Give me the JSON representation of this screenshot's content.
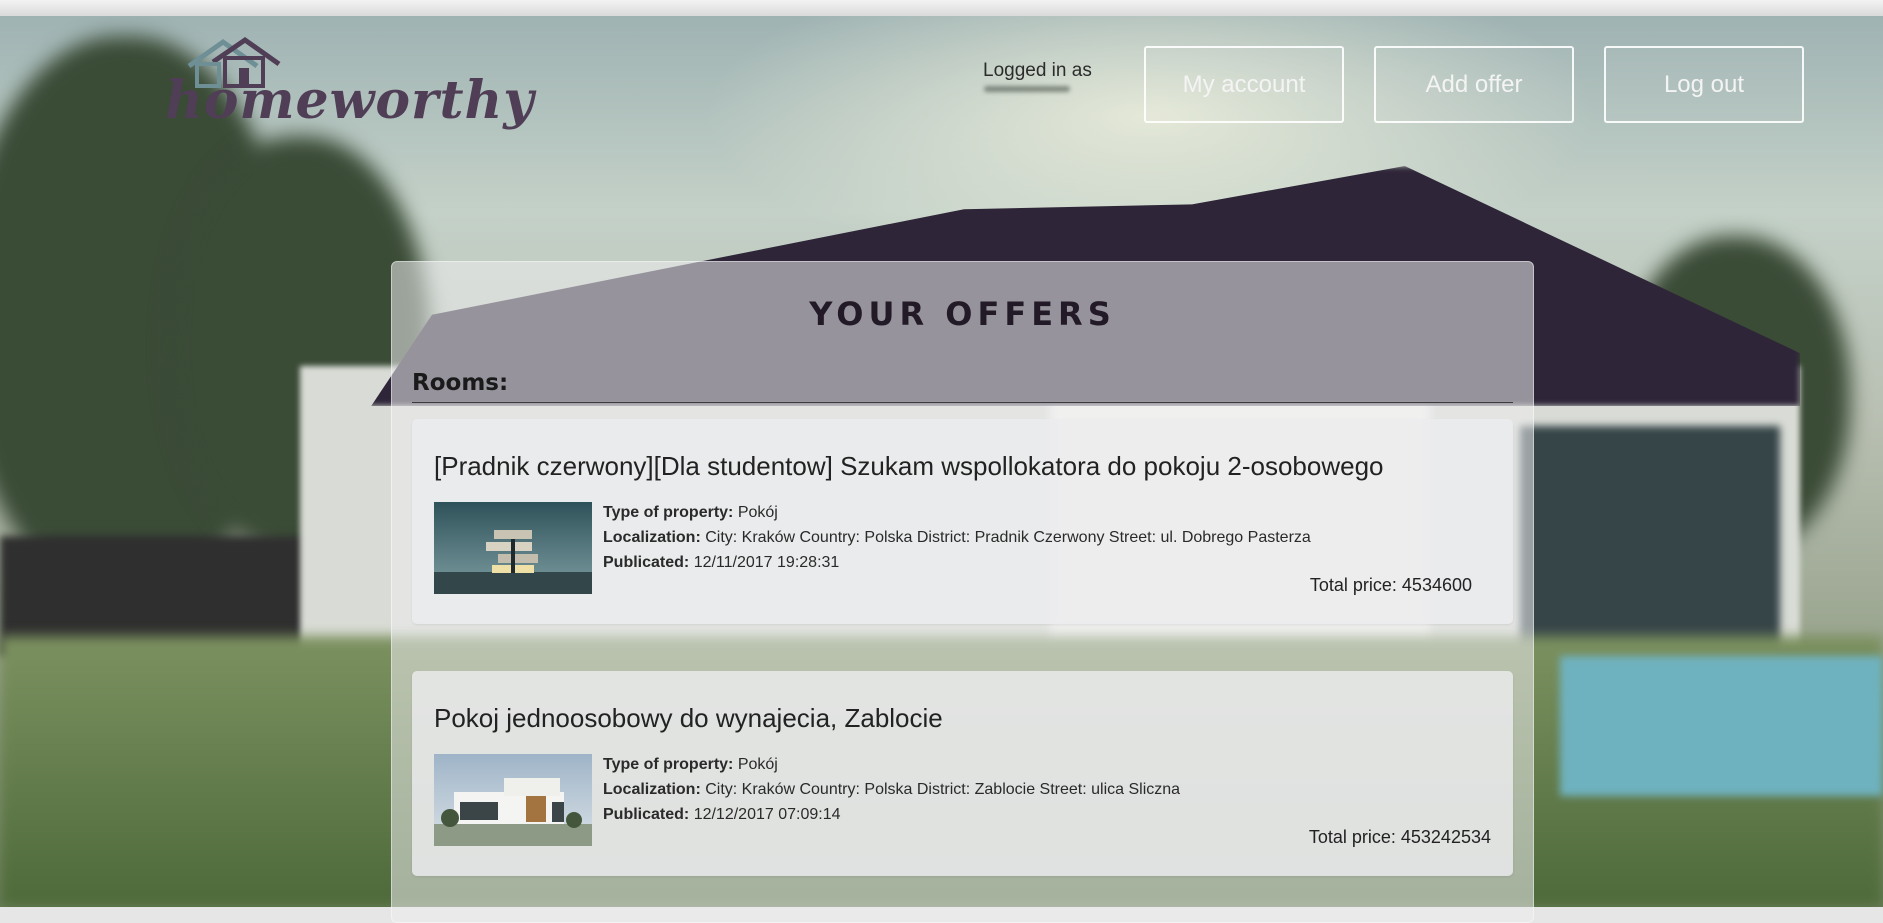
{
  "header": {
    "logo_text": "homeworthy",
    "logged_in_label": "Logged in as",
    "buttons": {
      "my_account": "My account",
      "add_offer": "Add offer",
      "log_out": "Log out"
    }
  },
  "main": {
    "title": "YOUR OFFERS",
    "section_label": "Rooms:",
    "offers": [
      {
        "title": "[Pradnik czerwony][Dla studentow] Szukam wspollokatora do pokoju 2-osobowego",
        "type_label": "Type of property:",
        "type_value": "Pokój",
        "localization_label": "Localization:",
        "localization_value": "City: Kraków Country: Polska District: Pradnik Czerwony Street: ul. Dobrego Pasterza",
        "published_label": "Publicated:",
        "published_value": "12/11/2017 19:28:31",
        "price_label": "Total price:",
        "price_value": "4534600"
      },
      {
        "title": "Pokoj jednoosobowy do wynajecia, Zablocie",
        "type_label": "Type of property:",
        "type_value": "Pokój",
        "localization_label": "Localization:",
        "localization_value": "City: Kraków Country: Polska District: Zablocie Street: ulica Sliczna",
        "published_label": "Publicated:",
        "published_value": "12/12/2017 07:09:14",
        "price_label": "Total price:",
        "price_value": "453242534"
      }
    ]
  },
  "colors": {
    "logo": "#4f3e55",
    "title": "#221a26",
    "button_border": "#ffffff"
  }
}
